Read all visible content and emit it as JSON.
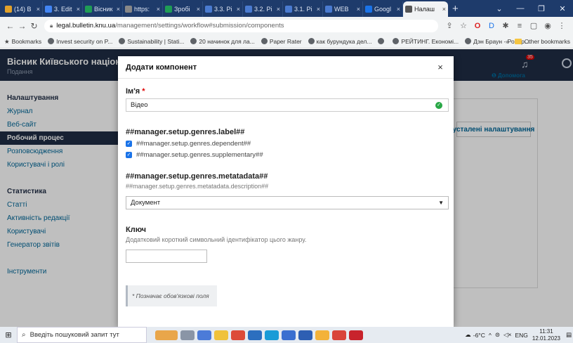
{
  "browser": {
    "tabs": [
      {
        "label": "(14) B",
        "color": "#e1a12b"
      },
      {
        "label": "3. Edit",
        "color": "#4285f4"
      },
      {
        "label": "Вісник",
        "color": "#1f9d55"
      },
      {
        "label": "https:",
        "color": "#888888"
      },
      {
        "label": "Зробі",
        "color": "#1f9d55"
      },
      {
        "label": "3.3. Рі",
        "color": "#4a7bd0"
      },
      {
        "label": "3.2. Рі",
        "color": "#4a7bd0"
      },
      {
        "label": "3.1. Рі",
        "color": "#4a7bd0"
      },
      {
        "label": "WEB",
        "color": "#4a7bd0"
      },
      {
        "label": "Googl",
        "color": "#1a73e8"
      },
      {
        "label": "Налаш",
        "color": "#555555",
        "active": true
      }
    ],
    "url_host": "legal.bulletin.knu.ua",
    "url_path": "/management/settings/workflow#submission/components",
    "bookmarks": [
      "Bookmarks",
      "Invest security on P...",
      "Sustainability | Stati...",
      "20 начинок для ла...",
      "Paper Rater",
      "как бурундука дел...",
      "",
      "РЕЙТИНГ. Економі...",
      "Дэн Браун - Робер..."
    ],
    "other_bookmarks": "Other bookmarks"
  },
  "site": {
    "title": "Вісник Київського національн",
    "title_sub": "Подання",
    "notif_count": "35",
    "help_label": "Допомога",
    "reset_label": "усталені налаштування"
  },
  "sidebar": {
    "section1": "Налаштування",
    "items1": [
      "Журнал",
      "Веб-сайт",
      "Робочий процес",
      "Розповсюдження",
      "Користувачі і ролі"
    ],
    "section2": "Статистика",
    "items2": [
      "Статті",
      "Активність редакції",
      "Користувачі",
      "Генератор звітів"
    ],
    "section3": "Інструменти"
  },
  "modal": {
    "title": "Додати компонент",
    "close": "×",
    "name_label": "Ім'я",
    "required_mark": "*",
    "name_value": "Відео",
    "genres_label": "##manager.setup.genres.label##",
    "chk1": "##manager.setup.genres.dependent##",
    "chk2": "##manager.setup.genres.supplementary##",
    "meta_label": "##manager.setup.genres.metatadata##",
    "meta_desc": "##manager.setup.genres.metatadata.description##",
    "meta_value": "Документ",
    "key_label": "Ключ",
    "key_desc": "Додатковий короткий символьний ідентифікатор цього жанру.",
    "required_note": "* Позначає обов'язкові поля"
  },
  "taskbar": {
    "search_placeholder": "Введіть пошуковий запит тут",
    "weather": "-6°C",
    "lang": "ENG",
    "time": "11:31",
    "date": "12.01.2023"
  }
}
